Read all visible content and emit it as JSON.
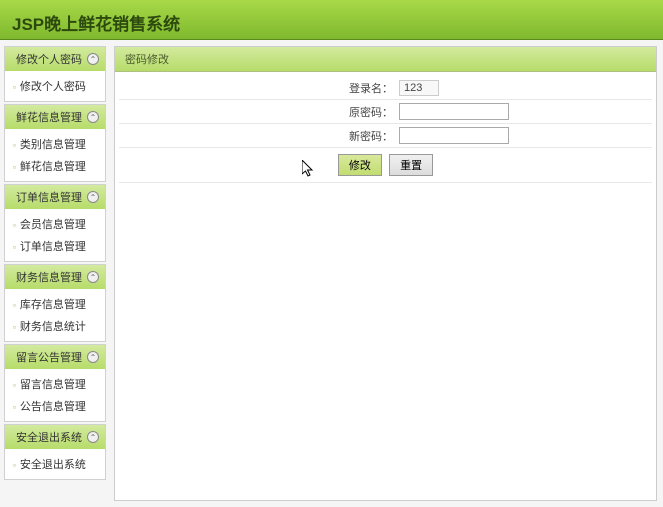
{
  "header": {
    "title": "JSP晚上鲜花销售系统"
  },
  "sidebar": {
    "groups": [
      {
        "title": "修改个人密码",
        "items": [
          "修改个人密码"
        ]
      },
      {
        "title": "鲜花信息管理",
        "items": [
          "类别信息管理",
          "鲜花信息管理"
        ]
      },
      {
        "title": "订单信息管理",
        "items": [
          "会员信息管理",
          "订单信息管理"
        ]
      },
      {
        "title": "财务信息管理",
        "items": [
          "库存信息管理",
          "财务信息统计"
        ]
      },
      {
        "title": "留言公告管理",
        "items": [
          "留言信息管理",
          "公告信息管理"
        ]
      },
      {
        "title": "安全退出系统",
        "items": [
          "安全退出系统"
        ]
      }
    ]
  },
  "main": {
    "panel_title": "密码修改",
    "login_label": "登录名：",
    "login_value": "123",
    "old_pwd_label": "原密码：",
    "new_pwd_label": "新密码：",
    "submit_label": "修改",
    "reset_label": "重置"
  }
}
